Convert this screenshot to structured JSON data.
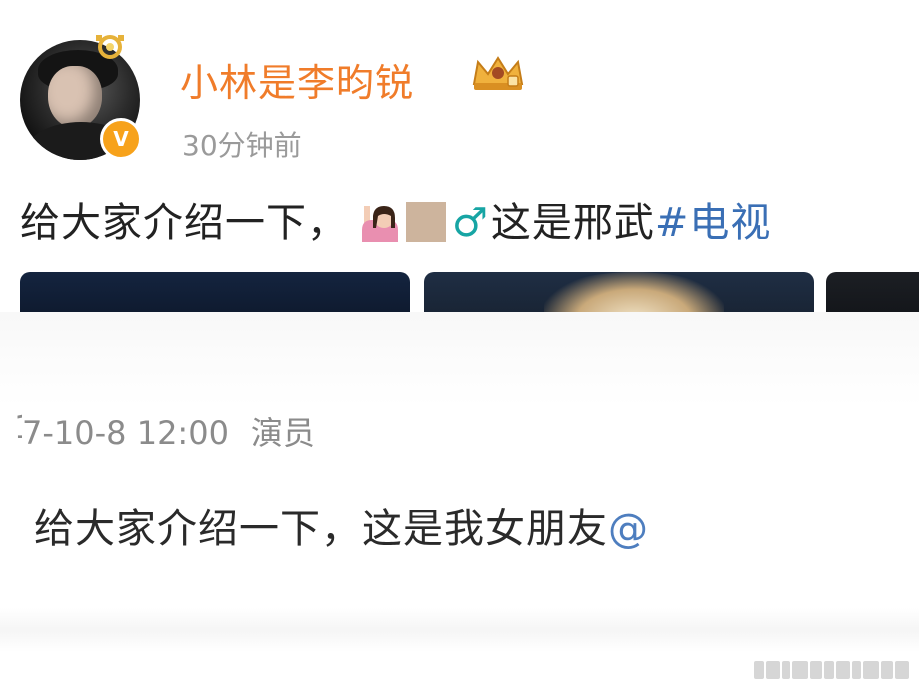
{
  "post": {
    "username": "小林是李昀锐",
    "timestamp": "30分钟前",
    "verified_badge": "V",
    "text_before": "给大家介绍一下，",
    "male_sign": "♂",
    "text_after": "这是邢武",
    "hashtag": "#电视",
    "icons": {
      "vip": "crown-icon",
      "gesture": "person-raising-hand-emoji",
      "skin_tone": "skin-tone-modifier",
      "decoration": "gold-ring-icon"
    },
    "colors": {
      "username": "#f07c2a",
      "hashtag": "#3a6fb5",
      "male_sign": "#17a5a4",
      "badge": "#f7a21b"
    }
  },
  "old_post": {
    "date_partial": "7-10-8 12:00",
    "source": "演员",
    "text": "给大家介绍一下，这是我女朋友",
    "mention": "@",
    "colors": {
      "meta": "#8b8b8b",
      "mention": "#4e7ebf"
    }
  }
}
